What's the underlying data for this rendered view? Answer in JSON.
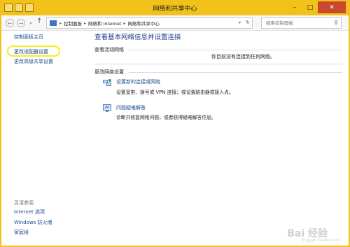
{
  "window": {
    "title": "网络和共享中心"
  },
  "address": {
    "crumbs": [
      "控制面板",
      "网络和 Internet",
      "网络和共享中心"
    ],
    "search_placeholder": "搜索控制面板"
  },
  "sidebar": {
    "items": [
      {
        "label": "控制面板主页"
      },
      {
        "label": "更改适配器设置"
      },
      {
        "label": "更改高级共享设置"
      }
    ],
    "see_also_heading": "另请参阅",
    "see_also": [
      {
        "label": "Internet 选项"
      },
      {
        "label": "Windows 防火墙"
      },
      {
        "label": "家庭组"
      }
    ]
  },
  "main": {
    "title": "查看基本网络信息并设置连接",
    "active_networks_label": "查看活动网络",
    "no_network_text": "你目前没有连接到任何网络。",
    "change_settings_label": "更改网络设置",
    "tasks": [
      {
        "link": "设置新的连接或网络",
        "description": "设置宽带、拨号或 VPN 连接；或设置路由器或接入点。"
      },
      {
        "link": "问题疑难解答",
        "description": "诊断并修复网络问题，或者获得疑难解答信息。"
      }
    ]
  },
  "watermark": {
    "text": "Bai 经验",
    "sub": "jingyan.baidu.com"
  },
  "colors": {
    "frame": "#f2c21b",
    "link": "#1b4d8e",
    "title": "#1e3e8c",
    "highlight": "#f5ef1a"
  }
}
